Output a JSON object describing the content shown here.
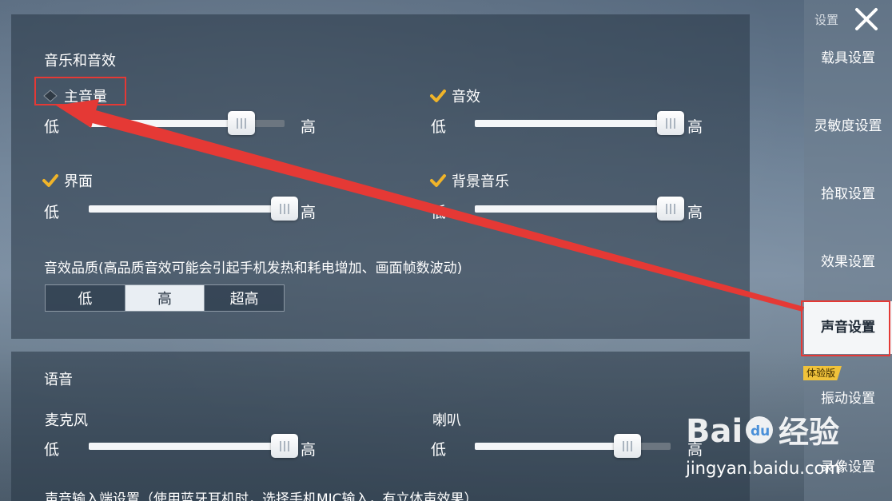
{
  "audio": {
    "title": "音乐和音效",
    "master": {
      "label": "主音量",
      "low": "低",
      "high": "高",
      "level": 0.78
    },
    "sfx": {
      "label": "音效",
      "low": "低",
      "high": "高",
      "level": 1.0
    },
    "ui": {
      "label": "界面",
      "low": "低",
      "high": "高",
      "level": 1.0
    },
    "bgm": {
      "label": "背景音乐",
      "low": "低",
      "high": "高",
      "level": 1.0
    },
    "quality": {
      "label": "音效品质(高品质音效可能会引起手机发热和耗电增加、画面帧数波动)",
      "options": [
        "低",
        "高",
        "超高"
      ],
      "selected": "高"
    }
  },
  "voice": {
    "title": "语音",
    "mic": {
      "label": "麦克风",
      "low": "低",
      "high": "高",
      "level": 1.0
    },
    "speaker": {
      "label": "喇叭",
      "low": "低",
      "high": "高",
      "level": 0.78
    },
    "input_label": "声音输入端设置（使用蓝牙耳机时，选择手机MIC输入，有立体声效果）"
  },
  "sidebar": {
    "title": "设置",
    "items": [
      "载具设置",
      "灵敏度设置",
      "拾取设置",
      "效果设置",
      "声音设置",
      "振动设置",
      "录像设置"
    ],
    "active": "声音设置",
    "badge": "体验版"
  },
  "watermark": {
    "text": "Bai 经验",
    "url": "jingyan.baidu.com"
  },
  "colors": {
    "accent_check": "#f0b429",
    "annotation": "#e53935",
    "active_nav_bg": "#f4f6f8"
  },
  "icons": {
    "master": "diamond-icon",
    "checked": "check-icon",
    "close": "close-icon"
  }
}
